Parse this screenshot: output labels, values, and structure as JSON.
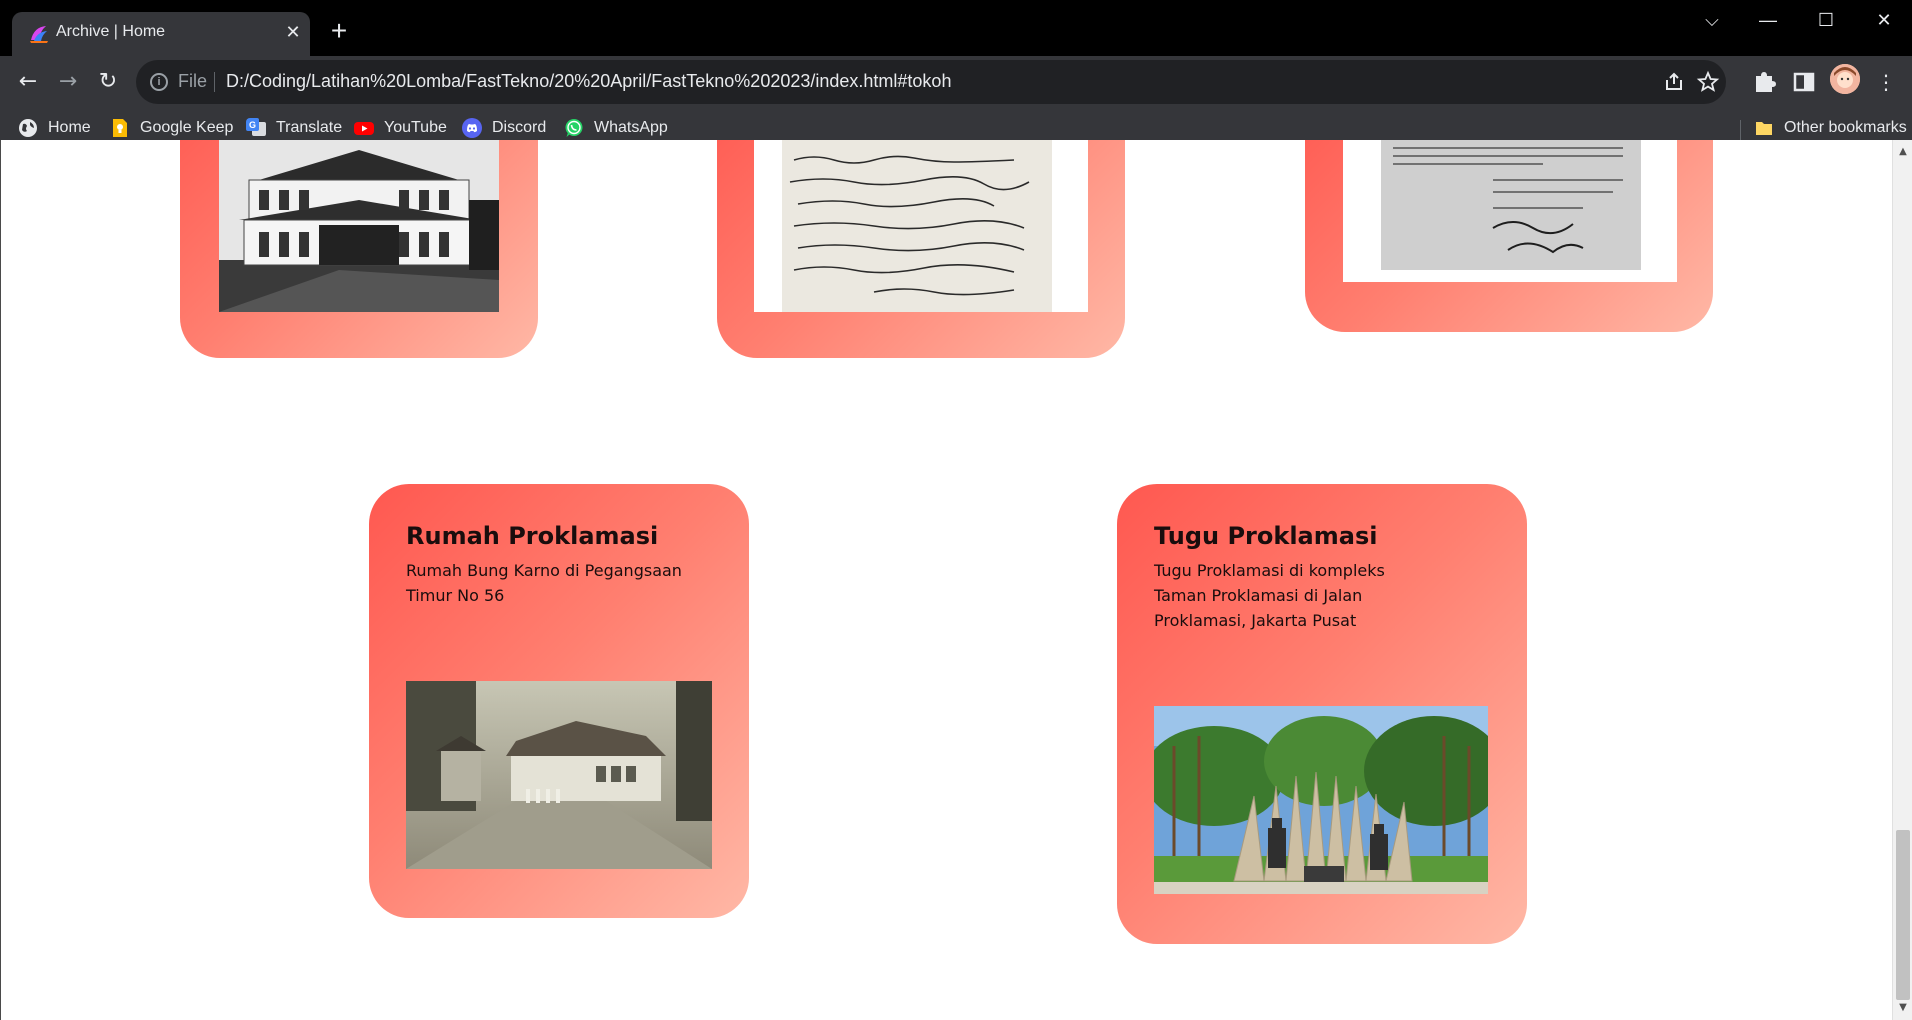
{
  "browser": {
    "tab_title": "Archive | Home",
    "tab_close": "✕",
    "new_tab": "+",
    "file_label": "File",
    "url": "D:/Coding/Latihan%20Lomba/FastTekno/20%20April/FastTekno%202023/index.html#tokoh",
    "window_controls": {
      "dropdown": "⌵",
      "minimize": "—",
      "maximize": "☐",
      "close": "✕"
    },
    "nav": {
      "back": "←",
      "forward": "→",
      "reload": "↻"
    }
  },
  "bookmarks": {
    "items": [
      {
        "label": "Home",
        "icon": "globe-icon",
        "color": "#e8eaed"
      },
      {
        "label": "Google Keep",
        "icon": "google-keep-icon",
        "color": "#fbbc04"
      },
      {
        "label": "Translate",
        "icon": "google-translate-icon",
        "color": "#4285f4"
      },
      {
        "label": "YouTube",
        "icon": "youtube-icon",
        "color": "#ff0000"
      },
      {
        "label": "Discord",
        "icon": "discord-icon",
        "color": "#5865f2"
      },
      {
        "label": "WhatsApp",
        "icon": "whatsapp-icon",
        "color": "#25d366"
      }
    ],
    "other_bookmarks": "Other bookmarks"
  },
  "cards": {
    "rumah": {
      "title": "Rumah Proklamasi",
      "desc_lines": [
        "Rumah Bung Karno di Pegangsaan",
        "Timur No 56"
      ]
    },
    "tugu": {
      "title": "Tugu Proklamasi",
      "desc_lines": [
        "Tugu Proklamasi di kompleks",
        "Taman Proklamasi di Jalan",
        "Proklamasi, Jakarta Pusat"
      ]
    }
  },
  "colors": {
    "card_gradient_start": "#ff5850",
    "card_gradient_end": "#ffb8a6",
    "chrome_dark": "#35363a",
    "titlebar": "#000000"
  }
}
